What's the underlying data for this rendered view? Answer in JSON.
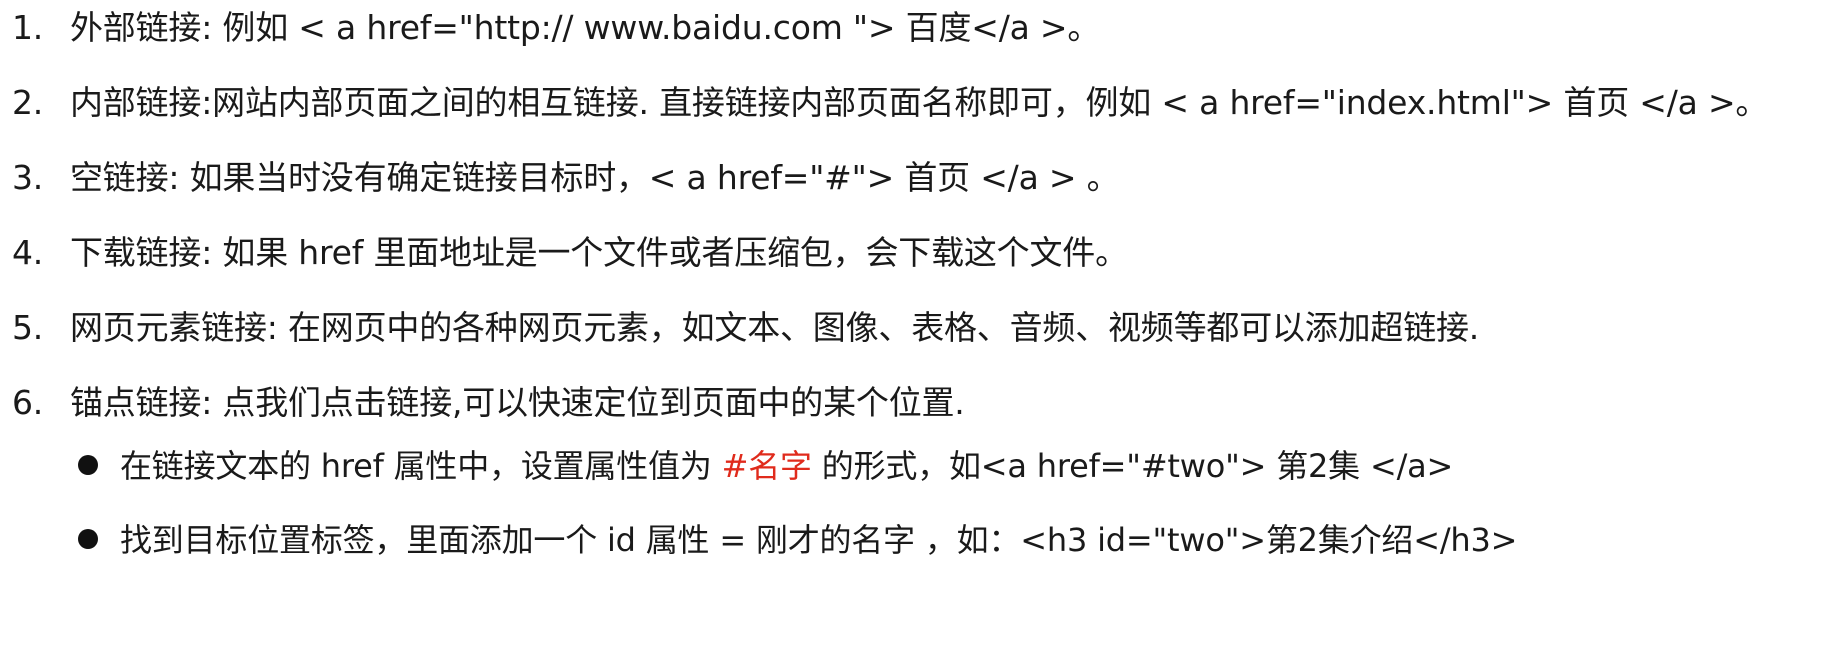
{
  "accent_color": "#e02b1c",
  "items": [
    {
      "number": "1.",
      "text": "外部链接: 例如 < a href=\"http:// www.baidu.com \"> 百度</a >。"
    },
    {
      "number": "2.",
      "text": "内部链接:网站内部页面之间的相互链接. 直接链接内部页面名称即可，例如 < a href=\"index.html\"> 首页 </a >。"
    },
    {
      "number": "3.",
      "text": "空链接: 如果当时没有确定链接目标时，< a href=\"#\"> 首页 </a > 。"
    },
    {
      "number": "4.",
      "text": "下载链接: 如果 href 里面地址是一个文件或者压缩包，会下载这个文件。"
    },
    {
      "number": "5.",
      "text": "网页元素链接: 在网页中的各种网页元素，如文本、图像、表格、音频、视频等都可以添加超链接."
    },
    {
      "number": "6.",
      "text": "锚点链接: 点我们点击链接,可以快速定位到页面中的某个位置."
    }
  ],
  "sub_items": [
    {
      "before": "在链接文本的 href 属性中，设置属性值为 ",
      "highlight": "#名字",
      "after": " 的形式，如<a href=\"#two\"> 第2集 </a>"
    },
    {
      "text": "找到目标位置标签，里面添加一个 id 属性 = 刚才的名字 ，如：<h3 id=\"two\">第2集介绍</h3>"
    }
  ]
}
